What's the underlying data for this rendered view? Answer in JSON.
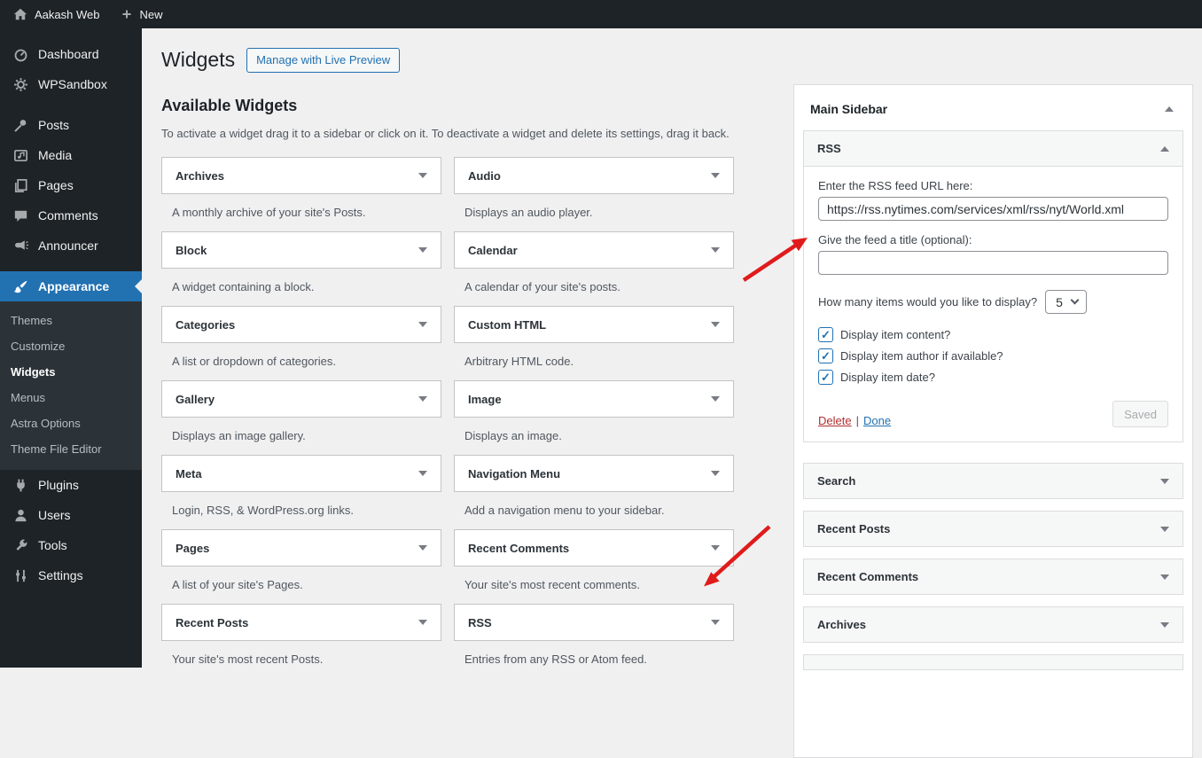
{
  "admin_bar": {
    "site_name": "Aakash Web",
    "new_label": "New"
  },
  "sidebar": {
    "items": [
      {
        "label": "Dashboard"
      },
      {
        "label": "WPSandbox"
      },
      {
        "label": "Posts"
      },
      {
        "label": "Media"
      },
      {
        "label": "Pages"
      },
      {
        "label": "Comments"
      },
      {
        "label": "Announcer"
      },
      {
        "label": "Appearance",
        "active": true
      },
      {
        "label": "Plugins"
      },
      {
        "label": "Users"
      },
      {
        "label": "Tools"
      },
      {
        "label": "Settings"
      }
    ],
    "appearance_submenu": [
      {
        "label": "Themes"
      },
      {
        "label": "Customize"
      },
      {
        "label": "Widgets",
        "active": true
      },
      {
        "label": "Menus"
      },
      {
        "label": "Astra Options"
      },
      {
        "label": "Theme File Editor"
      }
    ]
  },
  "page": {
    "title": "Widgets",
    "manage_button": "Manage with Live Preview"
  },
  "available_widgets": {
    "title": "Available Widgets",
    "description": "To activate a widget drag it to a sidebar or click on it. To deactivate a widget and delete its settings, drag it back.",
    "widgets": [
      {
        "name": "Archives",
        "description": "A monthly archive of your site's Posts."
      },
      {
        "name": "Audio",
        "description": "Displays an audio player."
      },
      {
        "name": "Block",
        "description": "A widget containing a block."
      },
      {
        "name": "Calendar",
        "description": "A calendar of your site's posts."
      },
      {
        "name": "Categories",
        "description": "A list or dropdown of categories."
      },
      {
        "name": "Custom HTML",
        "description": "Arbitrary HTML code."
      },
      {
        "name": "Gallery",
        "description": "Displays an image gallery."
      },
      {
        "name": "Image",
        "description": "Displays an image."
      },
      {
        "name": "Meta",
        "description": "Login, RSS, & WordPress.org links."
      },
      {
        "name": "Navigation Menu",
        "description": "Add a navigation menu to your sidebar."
      },
      {
        "name": "Pages",
        "description": "A list of your site's Pages."
      },
      {
        "name": "Recent Comments",
        "description": "Your site's most recent comments."
      },
      {
        "name": "Recent Posts",
        "description": "Your site's most recent Posts."
      },
      {
        "name": "RSS",
        "description": "Entries from any RSS or Atom feed."
      }
    ]
  },
  "main_sidebar": {
    "title": "Main Sidebar",
    "rss_widget": {
      "title": "RSS",
      "url_label": "Enter the RSS feed URL here:",
      "url_value": "https://rss.nytimes.com/services/xml/rss/nyt/World.xml",
      "feed_title_label": "Give the feed a title (optional):",
      "feed_title_value": "",
      "items_label": "How many items would you like to display?",
      "items_value": "5",
      "checkboxes": [
        {
          "label": "Display item content?",
          "checked": true
        },
        {
          "label": "Display item author if available?",
          "checked": true
        },
        {
          "label": "Display item date?",
          "checked": true
        }
      ],
      "delete_label": "Delete",
      "separator": "|",
      "done_label": "Done",
      "saved_label": "Saved"
    },
    "collapsed_widgets": [
      {
        "name": "Search"
      },
      {
        "name": "Recent Posts"
      },
      {
        "name": "Recent Comments"
      },
      {
        "name": "Archives"
      }
    ]
  },
  "colors": {
    "admin_bar_bg": "#1d2327",
    "accent_blue": "#2271b1",
    "active_menu_bg": "#2271b1",
    "arrow_red": "#e01b1b",
    "delete_red": "#b32d2e",
    "content_bg": "#f0f0f1",
    "widget_header_bg": "#f6f7f7"
  }
}
